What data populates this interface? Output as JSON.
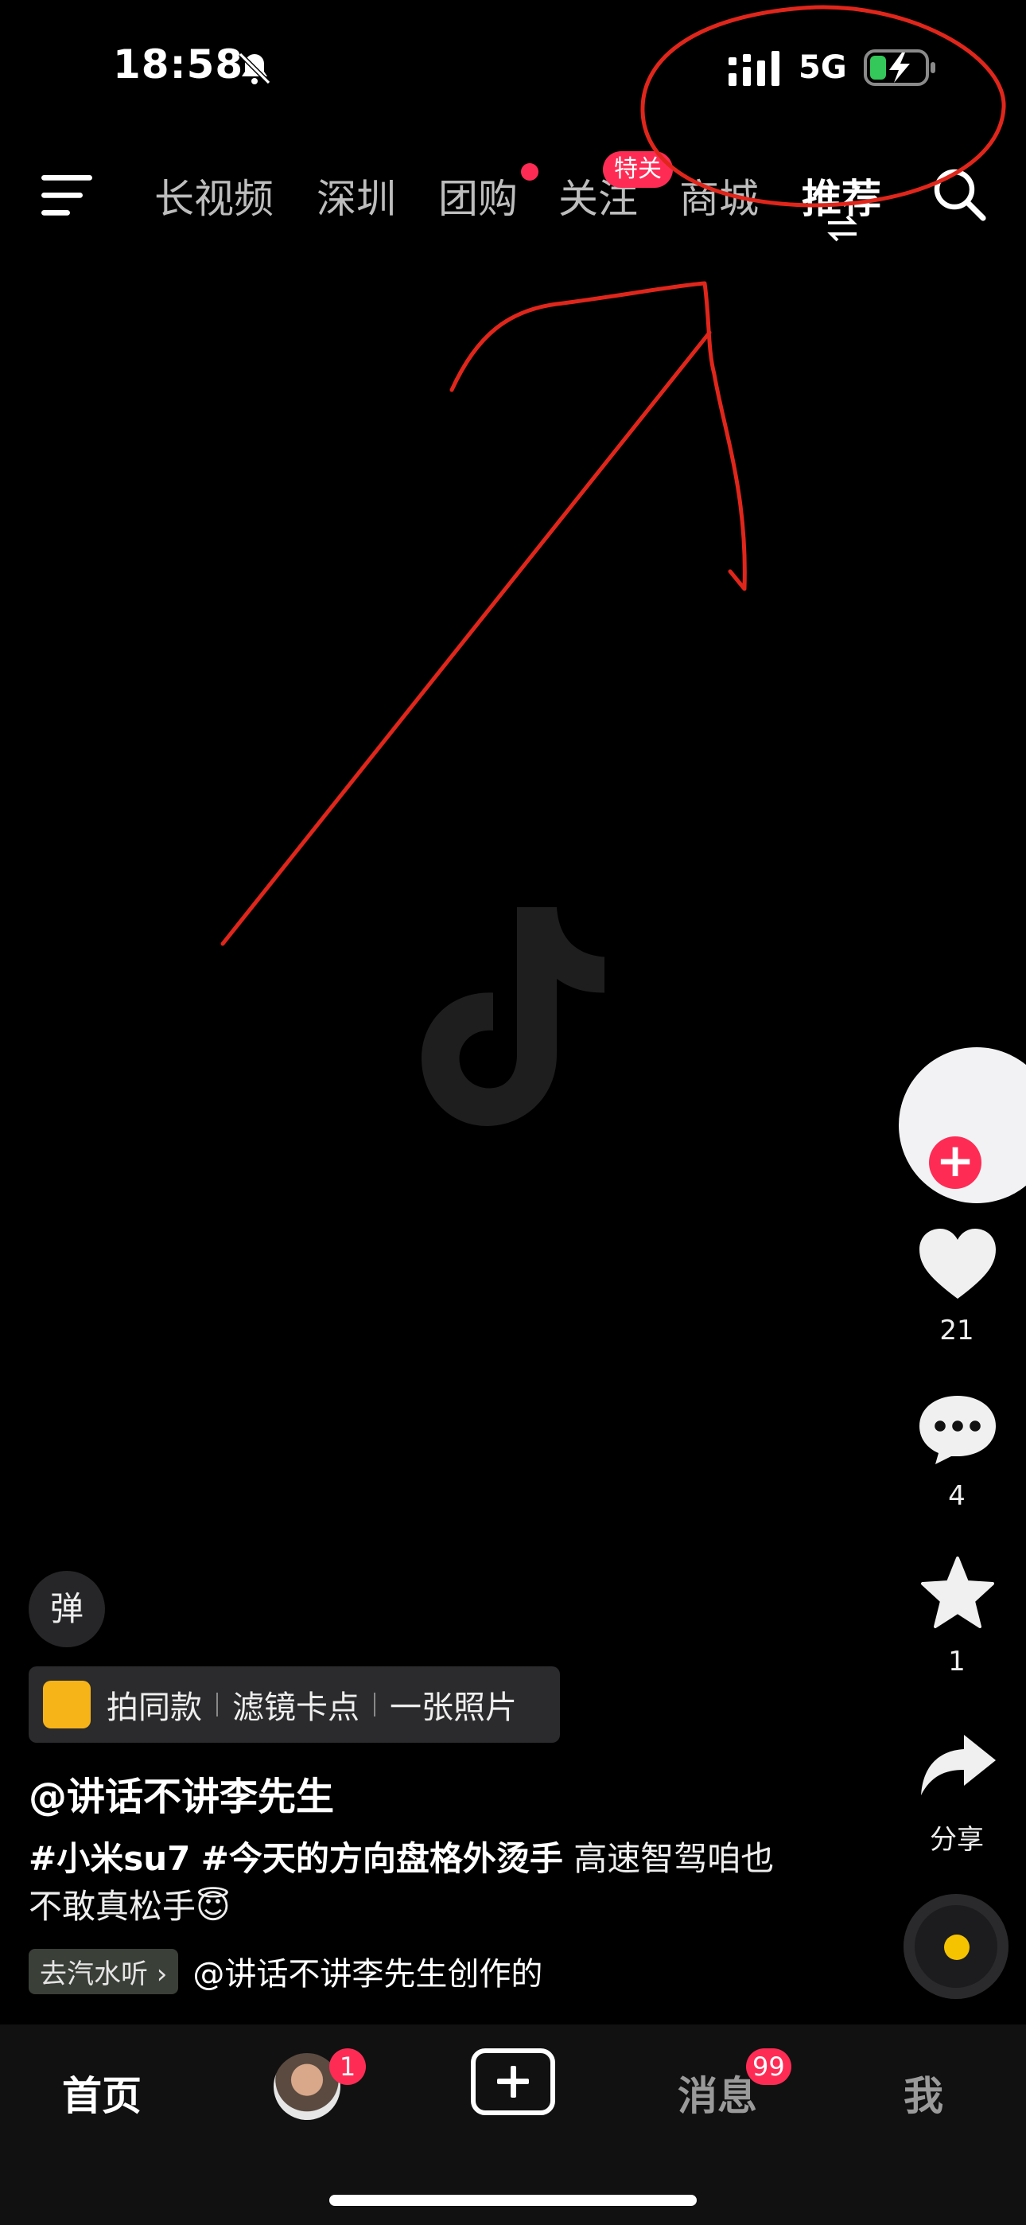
{
  "status": {
    "time": "18:58",
    "network": "5G"
  },
  "nav": {
    "tabs": [
      {
        "label": "长视频"
      },
      {
        "label": "深圳"
      },
      {
        "label": "团购"
      },
      {
        "label": "关注"
      },
      {
        "label": "商城"
      },
      {
        "label": "推荐"
      }
    ],
    "follow_badge": "特关"
  },
  "rail": {
    "likes": "21",
    "comments": "4",
    "favorites": "1",
    "share_label": "分享"
  },
  "danmu_label": "弹",
  "template": {
    "label": "拍同款",
    "tag1": "滤镜卡点",
    "tag2": "一张照片"
  },
  "post": {
    "author": "@讲话不讲李先生",
    "hashtag1": "#小米su7",
    "hashtag2": "#今天的方向盘格外烫手",
    "text_line1": "高速智驾咱也",
    "text_line2": "不敢真松手😇"
  },
  "music": {
    "button_label": "去汽水听",
    "text": "@讲话不讲李先生创作的"
  },
  "bottom_nav": {
    "home": "首页",
    "friends_badge": "1",
    "inbox": "消息",
    "inbox_badge": "99",
    "me": "我"
  },
  "colors": {
    "accent": "#fe2c55",
    "annotation": "#e0261b",
    "background": "#000000"
  }
}
